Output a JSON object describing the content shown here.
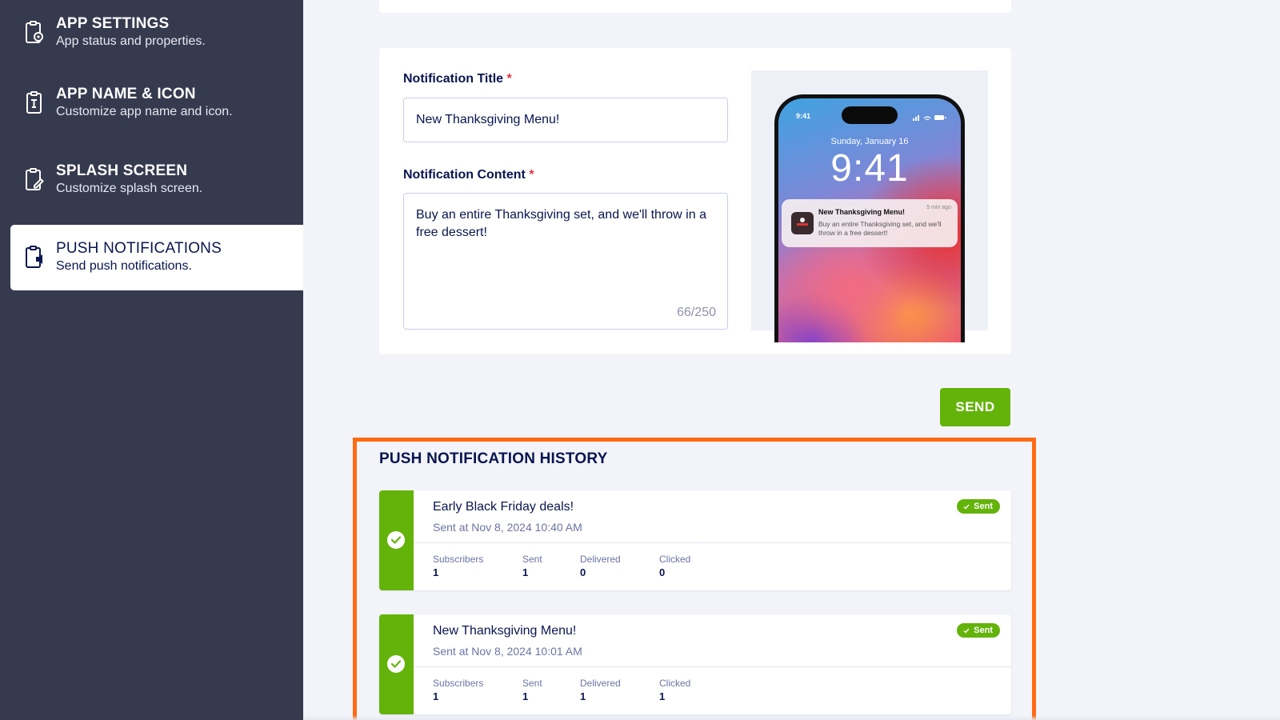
{
  "sidebar": {
    "items": [
      {
        "title": "APP SETTINGS",
        "subtitle": "App status and properties.",
        "icon": "settings-doc-icon"
      },
      {
        "title": "APP NAME & ICON",
        "subtitle": "Customize app name and icon.",
        "icon": "text-doc-icon"
      },
      {
        "title": "SPLASH SCREEN",
        "subtitle": "Customize splash screen.",
        "icon": "edit-doc-icon"
      },
      {
        "title": "PUSH NOTIFICATIONS",
        "subtitle": "Send push notifications.",
        "icon": "push-doc-icon",
        "active": true
      }
    ]
  },
  "form": {
    "title_label": "Notification Title",
    "title_value": "New Thanksgiving Menu!",
    "content_label": "Notification Content",
    "content_value": "Buy an entire Thanksgiving set, and we'll throw in a free dessert!",
    "counter": "66/250",
    "required_mark": "*"
  },
  "preview": {
    "status_time": "9:41",
    "date": "Sunday, January 16",
    "time": "9:41",
    "notif_title": "New Thanksgiving Menu!",
    "notif_time": "5 min ago",
    "notif_body": "Buy an entire Thanksgiving set, and we'll throw in a free dessert!"
  },
  "send_label": "SEND",
  "history": {
    "title": "PUSH NOTIFICATION HISTORY",
    "stat_labels": {
      "subscribers": "Subscribers",
      "sent": "Sent",
      "delivered": "Delivered",
      "clicked": "Clicked"
    },
    "items": [
      {
        "title": "Early Black Friday deals!",
        "time": "Sent at Nov 8, 2024 10:40 AM",
        "badge": "Sent",
        "subscribers": "1",
        "sent": "1",
        "delivered": "0",
        "clicked": "0"
      },
      {
        "title": "New Thanksgiving Menu!",
        "time": "Sent at Nov 8, 2024 10:01 AM",
        "badge": "Sent",
        "subscribers": "1",
        "sent": "1",
        "delivered": "1",
        "clicked": "1"
      }
    ]
  },
  "colors": {
    "sidebar": "#363a4f",
    "accent_green": "#64b30b",
    "highlight_orange": "#ff6a13",
    "text_navy": "#0a1551"
  }
}
